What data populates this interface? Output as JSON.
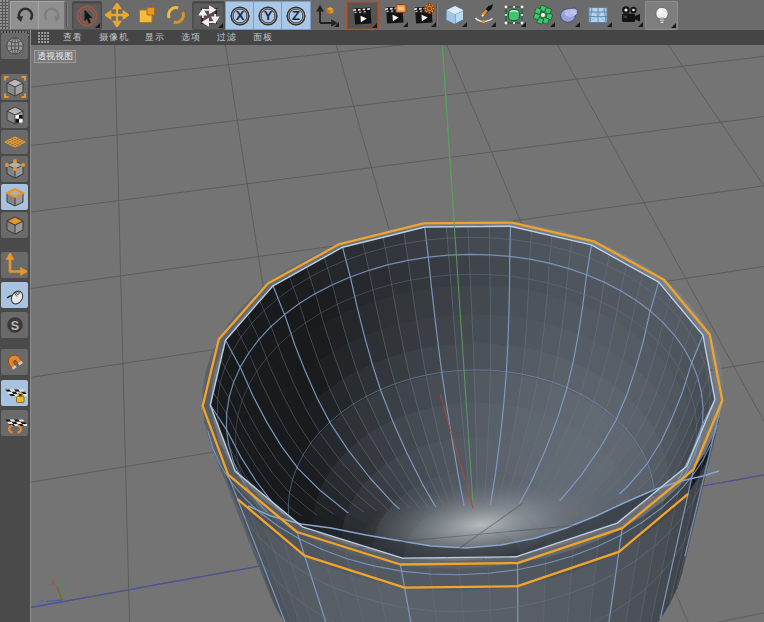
{
  "toolbar": {
    "buttons": [
      {
        "name": "undo"
      },
      {
        "name": "redo"
      },
      {
        "name": "live-selection",
        "active": true
      },
      {
        "name": "move"
      },
      {
        "name": "scale"
      },
      {
        "name": "rotate"
      },
      {
        "name": "last-used-tools",
        "active": true
      },
      {
        "name": "lock-x-axis",
        "label": "X"
      },
      {
        "name": "lock-y-axis",
        "label": "Y"
      },
      {
        "name": "lock-z-axis",
        "label": "Z"
      },
      {
        "name": "coordinate-system"
      },
      {
        "name": "render-view",
        "highlighted": true
      },
      {
        "name": "render-to-picture-viewer"
      },
      {
        "name": "render-settings"
      },
      {
        "name": "add-cube-primitive"
      },
      {
        "name": "pen-spline"
      },
      {
        "name": "subdivision-surface"
      },
      {
        "name": "array-generator"
      },
      {
        "name": "metaball"
      },
      {
        "name": "floor-environment"
      },
      {
        "name": "camera"
      },
      {
        "name": "light"
      }
    ]
  },
  "sidebar": {
    "buttons": [
      {
        "name": "make-editable"
      },
      {
        "name": "model-mode"
      },
      {
        "name": "texture-mode"
      },
      {
        "name": "workplane-mode"
      },
      {
        "name": "points-mode"
      },
      {
        "name": "edges-mode",
        "active": true
      },
      {
        "name": "polygons-mode"
      },
      {
        "name": "enable-axis"
      },
      {
        "name": "tweak-mode",
        "active": true
      },
      {
        "name": "enable-snap"
      },
      {
        "name": "snap-magnet"
      },
      {
        "name": "workplane-lock",
        "active": true
      },
      {
        "name": "workplane-snap"
      }
    ]
  },
  "viewport": {
    "menu": [
      "查看",
      "摄像机",
      "显示",
      "选项",
      "过滤",
      "面板"
    ],
    "label": "透视视图"
  }
}
